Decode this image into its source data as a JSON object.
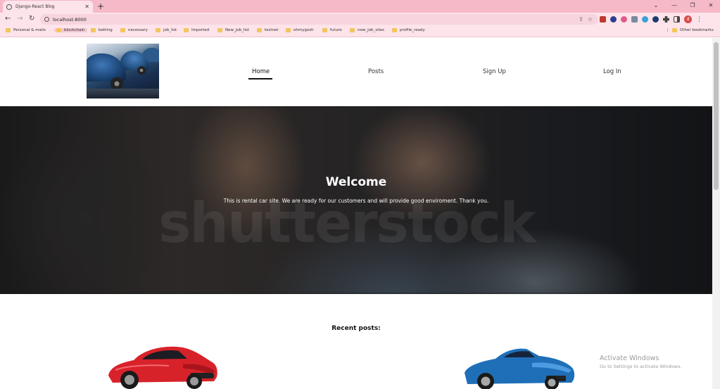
{
  "browser": {
    "tab_title": "Django-React Blog",
    "tab_close": "✕",
    "new_tab": "+",
    "window_controls": [
      "⌄",
      "—",
      "❐",
      "✕"
    ],
    "back": "←",
    "forward": "→",
    "reload": "↻",
    "url": "localhost:8000",
    "profile_initial": "d",
    "bookmarks": [
      "Personal & mails",
      "blockchain",
      "betting",
      "necessary",
      "job_list",
      "Imported",
      "New_job_list",
      "testnet",
      "ohmygosh",
      "future",
      "new_job_sites",
      "profile_ready"
    ],
    "other_bookmarks": "Other bookmarks"
  },
  "nav": {
    "home": "Home",
    "posts": "Posts",
    "signup": "Sign Up",
    "login": "Log In"
  },
  "hero": {
    "title": "Welcome",
    "text": "This is rental car site. We are ready for our customers and will provide good enviroment. Thank you.",
    "watermark": "shutterstock"
  },
  "recent": {
    "title": "Recent posts:"
  },
  "windows_notice": {
    "title": "Activate Windows",
    "subtitle": "Go to Settings to activate Windows."
  },
  "colors": {
    "tabstrip": "#f6b9c8",
    "toolbar": "#fde3ea",
    "red_car": "#d8222a",
    "blue_car": "#1f6fb8"
  }
}
